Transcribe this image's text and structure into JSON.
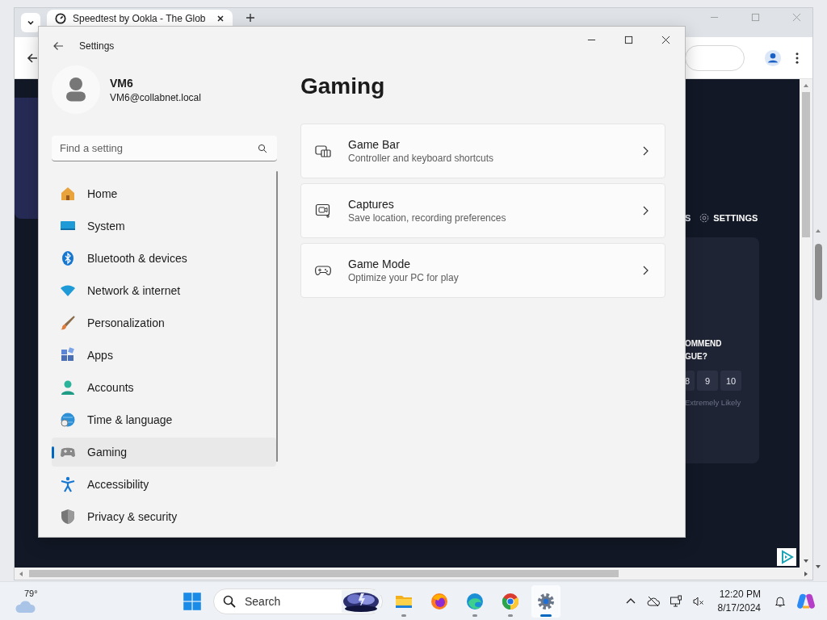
{
  "browser": {
    "tab_title": "Speedtest by Ookla - The Glob",
    "page": {
      "nav_partial": "S",
      "settings_link": "SETTINGS",
      "survey_lines": [
        "OMMEND",
        "GUE?"
      ],
      "scale": [
        "8",
        "9",
        "10"
      ],
      "scale_label": "Extremely Likely"
    }
  },
  "settings": {
    "title": "Settings",
    "user": {
      "name": "VM6",
      "email": "VM6@collabnet.local"
    },
    "search": {
      "placeholder": "Find a setting"
    },
    "nav": [
      {
        "label": "Home",
        "kind": "home",
        "selected": false
      },
      {
        "label": "System",
        "kind": "system",
        "selected": false
      },
      {
        "label": "Bluetooth & devices",
        "kind": "bluetooth",
        "selected": false
      },
      {
        "label": "Network & internet",
        "kind": "network",
        "selected": false
      },
      {
        "label": "Personalization",
        "kind": "brush",
        "selected": false
      },
      {
        "label": "Apps",
        "kind": "apps",
        "selected": false
      },
      {
        "label": "Accounts",
        "kind": "accounts",
        "selected": false
      },
      {
        "label": "Time & language",
        "kind": "time",
        "selected": false
      },
      {
        "label": "Gaming",
        "kind": "gaming",
        "selected": true
      },
      {
        "label": "Accessibility",
        "kind": "accessibility",
        "selected": false
      },
      {
        "label": "Privacy & security",
        "kind": "privacy",
        "selected": false
      }
    ],
    "page_title": "Gaming",
    "cards": [
      {
        "title": "Game Bar",
        "subtitle": "Controller and keyboard shortcuts",
        "kind": "gamebar"
      },
      {
        "title": "Captures",
        "subtitle": "Save location, recording preferences",
        "kind": "captures"
      },
      {
        "title": "Game Mode",
        "subtitle": "Optimize your PC for play",
        "kind": "gamemode"
      }
    ]
  },
  "taskbar": {
    "weather": "79°",
    "search": {
      "placeholder": "Search"
    },
    "apps": [
      {
        "kind": "explorer",
        "running": true,
        "selected": false
      },
      {
        "kind": "firefox",
        "running": false,
        "selected": false
      },
      {
        "kind": "edge",
        "running": true,
        "selected": false
      },
      {
        "kind": "chrome",
        "running": true,
        "selected": false
      },
      {
        "kind": "settings",
        "running": true,
        "selected": true
      }
    ],
    "time": "12:20 PM",
    "date": "8/17/2024"
  }
}
